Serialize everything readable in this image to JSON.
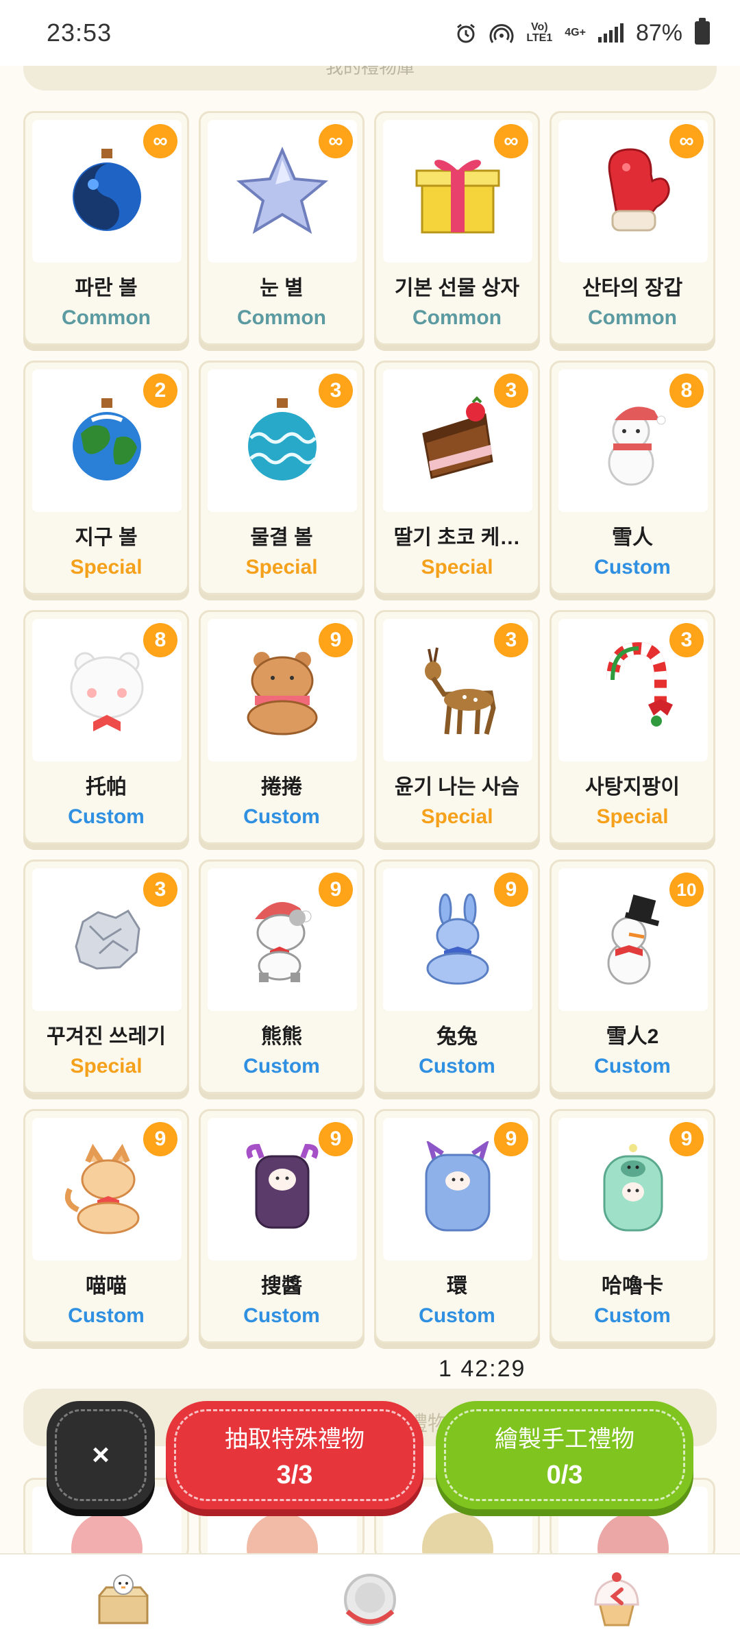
{
  "status_bar": {
    "time": "23:53",
    "network_top": "Vo)",
    "network_bottom": "LTE1",
    "net_type": "4G+",
    "battery": "87%"
  },
  "top_panel_text": "我的禮物庫",
  "items": [
    {
      "name": "파란 볼",
      "rarity": "Common",
      "badge": "∞",
      "icon": "blue-ornament-icon"
    },
    {
      "name": "눈 별",
      "rarity": "Common",
      "badge": "∞",
      "icon": "star-icon"
    },
    {
      "name": "기본 선물 상자",
      "rarity": "Common",
      "badge": "∞",
      "icon": "gift-box-icon"
    },
    {
      "name": "산타의 장갑",
      "rarity": "Common",
      "badge": "∞",
      "icon": "mitten-icon"
    },
    {
      "name": "지구 볼",
      "rarity": "Special",
      "badge": "2",
      "icon": "earth-ornament-icon"
    },
    {
      "name": "물결 볼",
      "rarity": "Special",
      "badge": "3",
      "icon": "wave-ornament-icon"
    },
    {
      "name": "딸기 초코 케…",
      "rarity": "Special",
      "badge": "3",
      "icon": "cake-icon"
    },
    {
      "name": "雪人",
      "rarity": "Custom",
      "badge": "8",
      "icon": "snowman-icon"
    },
    {
      "name": "托帕",
      "rarity": "Custom",
      "badge": "8",
      "icon": "white-bear-icon"
    },
    {
      "name": "捲捲",
      "rarity": "Custom",
      "badge": "9",
      "icon": "brown-bear-icon"
    },
    {
      "name": "윤기 나는 사슴",
      "rarity": "Special",
      "badge": "3",
      "icon": "deer-icon"
    },
    {
      "name": "사탕지팡이",
      "rarity": "Special",
      "badge": "3",
      "icon": "candy-cane-icon"
    },
    {
      "name": "꾸겨진 쓰레기",
      "rarity": "Special",
      "badge": "3",
      "icon": "crumpled-paper-icon"
    },
    {
      "name": "熊熊",
      "rarity": "Custom",
      "badge": "9",
      "icon": "santa-bear-icon"
    },
    {
      "name": "兔兔",
      "rarity": "Custom",
      "badge": "9",
      "icon": "blue-bunny-icon"
    },
    {
      "name": "雪人2",
      "rarity": "Custom",
      "badge": "10",
      "icon": "top-hat-snowman-icon"
    },
    {
      "name": "喵喵",
      "rarity": "Custom",
      "badge": "9",
      "icon": "cat-icon"
    },
    {
      "name": "搜醬",
      "rarity": "Custom",
      "badge": "9",
      "icon": "purple-monster-icon"
    },
    {
      "name": "環",
      "rarity": "Custom",
      "badge": "9",
      "icon": "blue-monster-icon"
    },
    {
      "name": "哈嚕卡",
      "rarity": "Custom",
      "badge": "9",
      "icon": "mint-monster-icon"
    }
  ],
  "countdown": "1 42:29",
  "lower_panel_text": "禮物",
  "buttons": {
    "close": "×",
    "special_label": "抽取特殊禮物",
    "special_count": "3/3",
    "craft_label": "繪製手工禮物",
    "craft_count": "0/3"
  },
  "colors": {
    "common": "#5b9aa0",
    "special": "#f5a11c",
    "custom": "#2f8fe0",
    "badge": "#ffa418",
    "special_button": "#e6353b",
    "craft_button": "#7fc41f"
  },
  "nav": [
    "gift-box-nav-icon",
    "plate-nav-icon",
    "cupcake-nav-icon"
  ]
}
